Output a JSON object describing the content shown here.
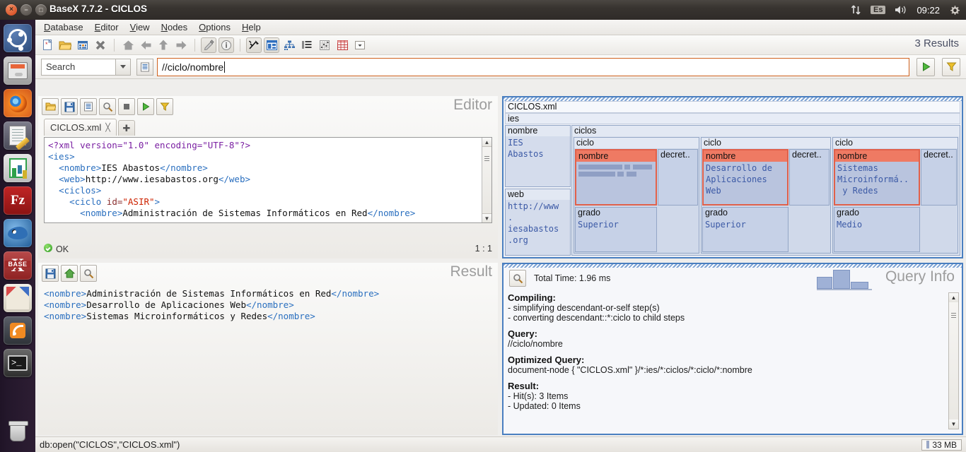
{
  "desktop": {
    "launcher_items": [
      {
        "name": "ubuntu-dash",
        "label": "Dash"
      },
      {
        "name": "files",
        "label": "Files"
      },
      {
        "name": "firefox",
        "label": "Firefox"
      },
      {
        "name": "text-editor",
        "label": "Text Editor"
      },
      {
        "name": "libreoffice-calc",
        "label": "LibreOffice Calc"
      },
      {
        "name": "filezilla",
        "label": "FileZilla",
        "text": "Fz"
      },
      {
        "name": "pidgin",
        "label": "Pidgin"
      },
      {
        "name": "basex",
        "label": "BaseX",
        "text": "X",
        "sub": "BASE"
      },
      {
        "name": "mosaic",
        "label": "Mosaic"
      },
      {
        "name": "rss-reader",
        "label": "RSS Reader"
      },
      {
        "name": "terminal",
        "label": "Terminal",
        "text": ">_"
      },
      {
        "name": "trash",
        "label": "Trash"
      }
    ],
    "tray": {
      "network_icon": "network-arrows-icon",
      "keyboard_layout": "Es",
      "volume_icon": "volume-icon",
      "clock": "09:22",
      "settings_icon": "gear-icon"
    }
  },
  "window": {
    "title": "BaseX 7.7.2 - CICLOS",
    "buttons": {
      "close": "×",
      "minimize": "−",
      "maximize": "□"
    }
  },
  "menubar": [
    {
      "label": "Database",
      "mnemonic": "D"
    },
    {
      "label": "Editor",
      "mnemonic": "E"
    },
    {
      "label": "View",
      "mnemonic": "V"
    },
    {
      "label": "Nodes",
      "mnemonic": "N"
    },
    {
      "label": "Options",
      "mnemonic": "O"
    },
    {
      "label": "Help",
      "mnemonic": "H"
    }
  ],
  "toolbar": {
    "icons": [
      {
        "name": "new-document-icon"
      },
      {
        "name": "open-folder-icon"
      },
      {
        "name": "database-icon"
      },
      {
        "name": "close-database-icon"
      },
      {
        "name": "home-icon"
      },
      {
        "name": "go-back-icon"
      },
      {
        "name": "go-up-icon"
      },
      {
        "name": "go-forward-icon"
      },
      {
        "name": "edit-pencil-icon"
      },
      {
        "name": "info-icon"
      },
      {
        "name": "realtime-execution-icon"
      },
      {
        "name": "map-view-icon",
        "selected": true
      },
      {
        "name": "tree-view-icon"
      },
      {
        "name": "folder-view-icon"
      },
      {
        "name": "plot-view-icon"
      },
      {
        "name": "table-view-icon"
      },
      {
        "name": "view-dropdown-icon"
      }
    ],
    "results_label": "3 Results"
  },
  "searchbar": {
    "search_label": "Search",
    "dropdown_icon": "chevron-down-icon",
    "history_icon": "list-icon",
    "query_value": "//ciclo/nombre",
    "run_icon": "run-play-icon",
    "filter_icon": "filter-funnel-icon"
  },
  "editor": {
    "title": "Editor",
    "buttons": [
      {
        "name": "open-icon"
      },
      {
        "name": "save-icon"
      },
      {
        "name": "save-as-icon"
      },
      {
        "name": "find-icon"
      },
      {
        "name": "stop-icon"
      },
      {
        "name": "run-icon"
      },
      {
        "name": "filter-icon"
      }
    ],
    "tab": {
      "label": "CICLOS.xml",
      "close_icon": "close-tab-icon",
      "add_icon": "add-tab-icon"
    },
    "code_lines": [
      {
        "parts": [
          {
            "t": "<?xml version=\"1.0\" encoding=\"UTF-8\"?>",
            "c": "tag"
          }
        ]
      },
      {
        "parts": [
          {
            "t": "<ies>",
            "c": "tagb"
          }
        ]
      },
      {
        "parts": [
          {
            "t": "  ",
            "c": "plain"
          },
          {
            "t": "<nombre>",
            "c": "tagb"
          },
          {
            "t": "IES Abastos",
            "c": "plain"
          },
          {
            "t": "</nombre>",
            "c": "tagb"
          }
        ]
      },
      {
        "parts": [
          {
            "t": "  ",
            "c": "plain"
          },
          {
            "t": "<web>",
            "c": "tagb"
          },
          {
            "t": "http://www.iesabastos.org",
            "c": "plain"
          },
          {
            "t": "</web>",
            "c": "tagb"
          }
        ]
      },
      {
        "parts": [
          {
            "t": "  ",
            "c": "plain"
          },
          {
            "t": "<ciclos>",
            "c": "tagb"
          }
        ]
      },
      {
        "parts": [
          {
            "t": "    ",
            "c": "plain"
          },
          {
            "t": "<ciclo ",
            "c": "tagb"
          },
          {
            "t": "id=",
            "c": "attr"
          },
          {
            "t": "\"ASIR\"",
            "c": "aval"
          },
          {
            "t": ">",
            "c": "tagb"
          }
        ]
      },
      {
        "parts": [
          {
            "t": "      ",
            "c": "plain"
          },
          {
            "t": "<nombre>",
            "c": "tagb"
          },
          {
            "t": "Administración de Sistemas Informáticos en Red",
            "c": "plain"
          },
          {
            "t": "</nombre>",
            "c": "tagb"
          }
        ]
      }
    ],
    "status_ok": "OK",
    "cursor_position": "1 : 1"
  },
  "mapview": {
    "root_label": "CICLOS.xml",
    "ies_label": "ies",
    "nombre_label": "nombre",
    "nombre_value": "IES\nAbastos",
    "web_label": "web",
    "web_value": "http://www\n.\niesabastos\n.org",
    "ciclos_label": "ciclos",
    "ciclos": [
      {
        "ciclo_label": "ciclo",
        "nombre_label": "nombre",
        "nombre_value": "",
        "redacted": true,
        "decreto_label": "decret..",
        "grado_label": "grado",
        "grado_value": "Superior",
        "selected": true
      },
      {
        "ciclo_label": "ciclo",
        "nombre_label": "nombre",
        "nombre_value": "Desarrollo de\nAplicaciones\nWeb",
        "redacted": false,
        "decreto_label": "decret..",
        "grado_label": "grado",
        "grado_value": "Superior",
        "selected": true
      },
      {
        "ciclo_label": "ciclo",
        "nombre_label": "nombre",
        "nombre_value": "Sistemas\nMicroinformá..\n y Redes",
        "redacted": false,
        "decreto_label": "decret..",
        "grado_label": "grado",
        "grado_value": "Medio",
        "selected": true
      }
    ],
    "selection_color": "#ef7a63"
  },
  "result": {
    "title": "Result",
    "buttons": [
      {
        "name": "save-result-icon"
      },
      {
        "name": "home-icon"
      },
      {
        "name": "find-icon"
      }
    ],
    "lines": [
      {
        "open": "<nombre>",
        "text": "Administración de Sistemas Informáticos en Red",
        "close": "</nombre>"
      },
      {
        "open": "<nombre>",
        "text": "Desarrollo de Aplicaciones Web",
        "close": "</nombre>"
      },
      {
        "open": "<nombre>",
        "text": "Sistemas Microinformáticos y Redes",
        "close": "</nombre>"
      }
    ]
  },
  "queryinfo": {
    "title": "Query Info",
    "search_icon": "find-icon",
    "total_time": "Total Time: 1.96 ms",
    "blocks": [
      {
        "heading": "Compiling:",
        "lines": [
          "- simplifying descendant-or-self step(s)",
          "- converting descendant::*:ciclo to child steps"
        ]
      },
      {
        "heading": "Query:",
        "lines": [
          "//ciclo/nombre"
        ]
      },
      {
        "heading": "Optimized Query:",
        "lines": [
          "document-node { \"CICLOS.xml\" }/*:ies/*:ciclos/*:ciclo/*:nombre"
        ]
      },
      {
        "heading": "Result:",
        "lines": [
          "- Hit(s): 3 Items",
          "- Updated: 0 Items"
        ]
      }
    ],
    "bars": [
      40,
      62,
      22
    ]
  },
  "statusbar": {
    "command": "db:open(\"CICLOS\",\"CICLOS.xml\")",
    "memory": "33 MB"
  }
}
